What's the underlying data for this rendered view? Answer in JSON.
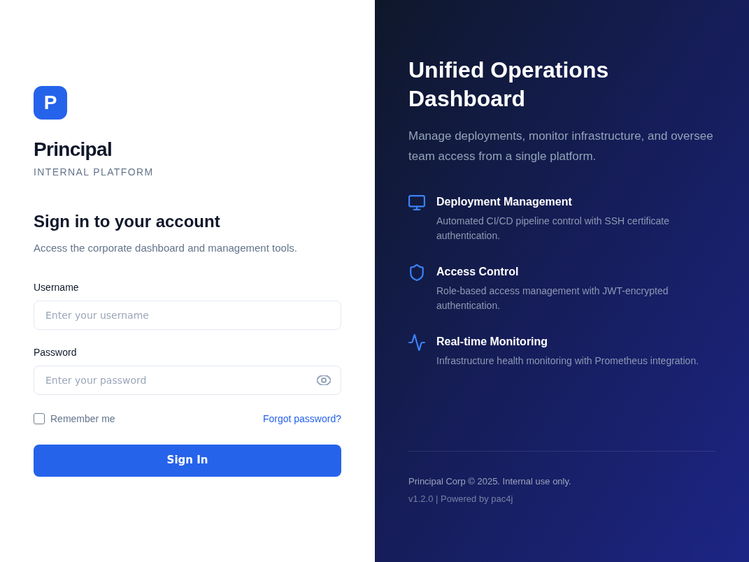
{
  "brand": {
    "logo_letter": "P",
    "name": "Principal",
    "tagline": "INTERNAL PLATFORM"
  },
  "form": {
    "heading": "Sign in to your account",
    "subheading": "Access the corporate dashboard and management tools.",
    "fields": [
      {
        "kind": "text",
        "label": "Username",
        "placeholder": "Enter your username"
      },
      {
        "kind": "password",
        "label": "Password",
        "placeholder": "Enter your password"
      }
    ],
    "remember": {
      "label": "Remember me",
      "checked": false
    },
    "forgot_link": "Forgot password?",
    "submit": "Sign In"
  },
  "hero": {
    "title": "Unified Operations Dashboard",
    "description": "Manage deployments, monitor infrastructure, and oversee team access from a single platform.",
    "features": [
      {
        "kind": "deployment",
        "title": "Deployment Management",
        "description": "Automated CI/CD pipeline control with SSH certificate authentication."
      },
      {
        "kind": "security",
        "title": "Access Control",
        "description": "Role-based access management with JWT-encrypted authentication."
      },
      {
        "kind": "monitoring",
        "title": "Real-time Monitoring",
        "description": "Infrastructure health monitoring with Prometheus integration."
      }
    ]
  },
  "footer": {
    "copyright": "Principal Corp © 2025. Internal use only.",
    "version": "v1.2.0 | Powered by pac4j"
  }
}
